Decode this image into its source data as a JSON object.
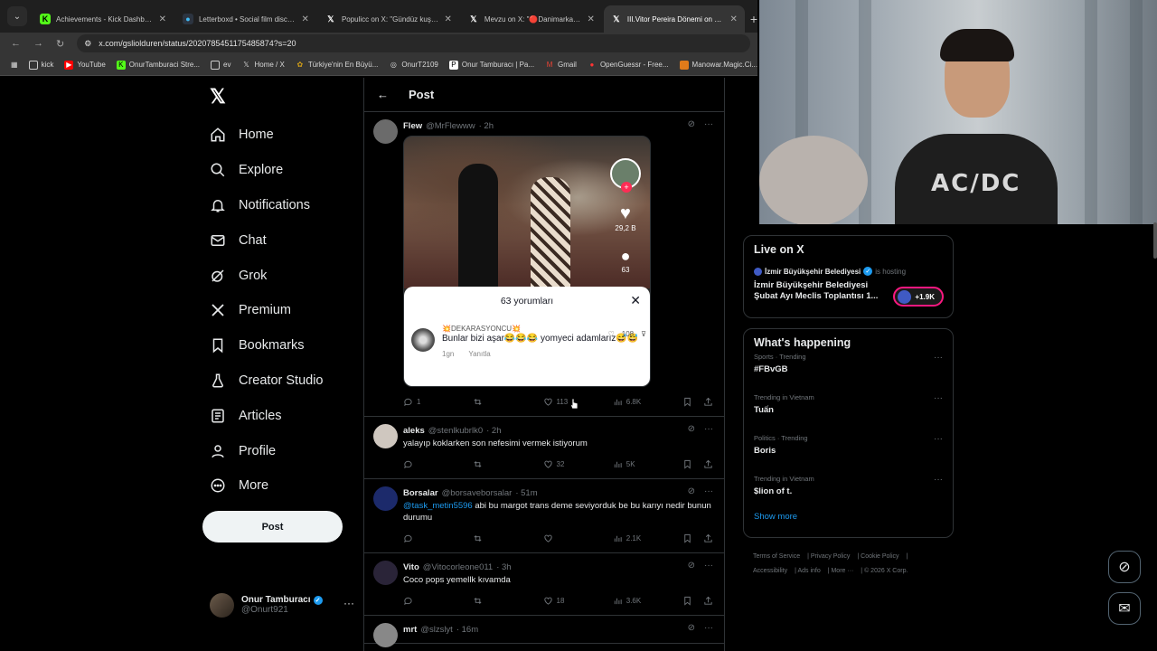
{
  "browser": {
    "tabs": [
      {
        "title": "Achievements - Kick Dashboard",
        "icon": "kick-icon",
        "color": "#53fc18",
        "active": false
      },
      {
        "title": "Letterboxd • Social film discove",
        "icon": "letterboxd-icon",
        "color": "#40bcf4",
        "active": false
      },
      {
        "title": "Populicc on X: \"Gündüz kuşağı",
        "icon": "x-icon",
        "color": "#ffffff",
        "active": false
      },
      {
        "title": "Mevzu on X: \"🔴Danimarka He",
        "icon": "x-icon",
        "color": "#ffffff",
        "active": false
      },
      {
        "title": "III.Vitor Pereira Dönemi on X: \"",
        "icon": "x-icon",
        "color": "#ffffff",
        "active": true
      }
    ],
    "url": "x.com/gsliolduren/status/2020785451175485874?s=20",
    "bookmarks": [
      "kick",
      "YouTube",
      "OnurTamburaci Stre...",
      "ev",
      "Home / X",
      "Türkiye'nin En Büyü...",
      "OnurT2109",
      "Onur Tamburacı | Pa...",
      "Gmail",
      "OpenGuessr - Free...",
      "Manowar.Magic.Ci..."
    ]
  },
  "sidebar": {
    "items": [
      {
        "label": "Home",
        "icon": "home-icon"
      },
      {
        "label": "Explore",
        "icon": "search-icon"
      },
      {
        "label": "Notifications",
        "icon": "bell-icon"
      },
      {
        "label": "Chat",
        "icon": "mail-icon"
      },
      {
        "label": "Grok",
        "icon": "grok-icon"
      },
      {
        "label": "Premium",
        "icon": "x-icon"
      },
      {
        "label": "Bookmarks",
        "icon": "bookmark-icon"
      },
      {
        "label": "Creator Studio",
        "icon": "flask-icon"
      },
      {
        "label": "Articles",
        "icon": "article-icon"
      },
      {
        "label": "Profile",
        "icon": "person-icon"
      },
      {
        "label": "More",
        "icon": "more-circle-icon"
      }
    ],
    "post_label": "Post",
    "account": {
      "name": "Onur Tamburacı",
      "handle": "@Onurt921"
    }
  },
  "main": {
    "title": "Post",
    "video": {
      "likes": "29,2 B",
      "comments": "63",
      "sheet_title": "63 yorumları",
      "comment_user": "💥DEKARASYONCU💥",
      "comment_text": "Bunlar bizi aşar😂😂😂 yomyeci adamlarız😅😅",
      "comment_time": "1gn",
      "comment_reply": "Yanıtla",
      "comment_likes": "108"
    },
    "tweets": [
      {
        "name": "Flew",
        "handle": "@MrFlewww",
        "time": "· 2h",
        "text": "",
        "mention": "",
        "replies": "1",
        "likes": "113",
        "views": "6.8K",
        "avatar": "#6b6b6b"
      },
      {
        "name": "aleks",
        "handle": "@stenlkubrlk0",
        "time": "· 2h",
        "text": "yalayıp koklarken son nefesimi vermek istiyorum",
        "mention": "",
        "replies": "",
        "likes": "32",
        "views": "5K",
        "avatar": "#cfc7bf"
      },
      {
        "name": "Borsalar",
        "handle": "@borsaveborsalar",
        "time": "· 51m",
        "text": "abi bu margot trans deme seviyorduk be bu karıyı nedir bunun durumu",
        "mention": "@task_metin5596",
        "replies": "",
        "likes": "",
        "views": "2.1K",
        "avatar": "#1c2a6b"
      },
      {
        "name": "Vito",
        "handle": "@Vitocorleone011",
        "time": "· 3h",
        "text": "Coco pops yemellk kıvamda",
        "mention": "",
        "replies": "",
        "likes": "18",
        "views": "3.6K",
        "avatar": "#2a2438"
      },
      {
        "name": "mrt",
        "handle": "@slzslyt",
        "time": "· 16m",
        "text": "",
        "mention": "",
        "replies": "",
        "likes": "",
        "views": "",
        "avatar": "#888888"
      }
    ]
  },
  "right": {
    "live_title": "Live on X",
    "live_host": "İzmir Büyükşehir Belediyesi",
    "live_host_suffix": "is hosting",
    "live_event": "İzmir Büyükşehir Belediyesi Şubat Ayı Meclis Toplantısı 1...",
    "live_count": "+1.9K",
    "happening_title": "What's happening",
    "trends": [
      {
        "meta": "Sports · Trending",
        "name": "#FBvGB"
      },
      {
        "meta": "Trending in Vietnam",
        "name": "Tuấn"
      },
      {
        "meta": "Politics · Trending",
        "name": "Boris"
      },
      {
        "meta": "Trending in Vietnam",
        "name": "$lion of t."
      }
    ],
    "show_more": "Show more",
    "footer": [
      "Terms of Service",
      "Privacy Policy",
      "Cookie Policy",
      "Accessibility",
      "Ads info",
      "More ···",
      "© 2026 X Corp."
    ]
  },
  "webcam": {
    "shirt_text": "AC/DC"
  }
}
